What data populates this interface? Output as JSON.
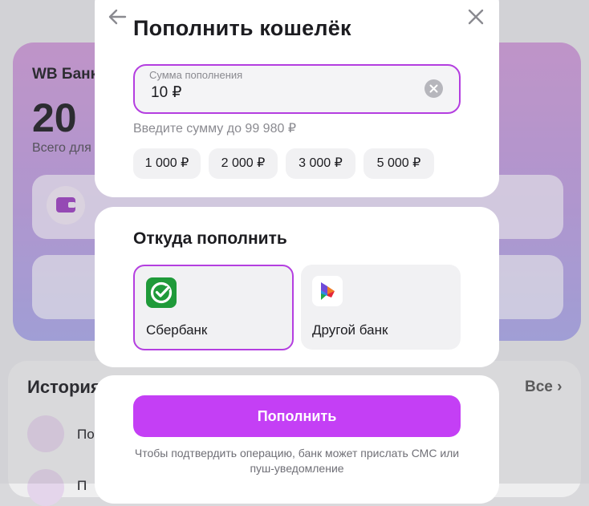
{
  "background": {
    "card_title": "WB Банк",
    "balance_visible": "20",
    "balance_caption": "Всего для",
    "history_title": "История",
    "history_all": "Все",
    "history_item_1": "По",
    "history_item_2": "П"
  },
  "modal": {
    "title": "Пополнить кошелёк",
    "back_icon": "arrow-left-icon",
    "close_icon": "close-icon",
    "amount": {
      "label": "Сумма пополнения",
      "value": "10 ₽",
      "accent": "#b43ee0"
    },
    "hint": "Введите сумму до 99 980 ₽",
    "chips": [
      "1 000 ₽",
      "2 000 ₽",
      "3 000 ₽",
      "5 000 ₽"
    ],
    "source": {
      "title": "Откуда пополнить",
      "options": [
        {
          "label": "Сбербанк",
          "selected": true,
          "icon": "sberbank-logo-icon"
        },
        {
          "label": "Другой банк",
          "selected": false,
          "icon": "sbp-logo-icon"
        }
      ]
    },
    "submit_label": "Пополнить",
    "submit_color": "#c43ff5",
    "note": "Чтобы подтвердить операцию, банк может прислать СМС или пуш-уведомление"
  }
}
